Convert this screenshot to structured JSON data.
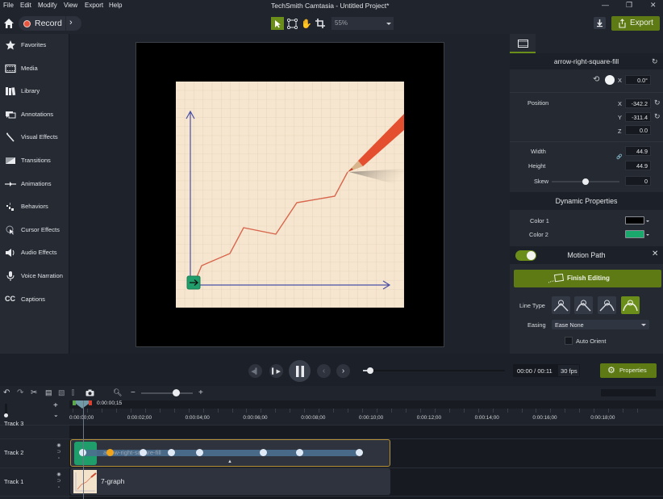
{
  "menu": {
    "items": [
      "File",
      "Edit",
      "Modify",
      "View",
      "Export",
      "Help"
    ]
  },
  "window": {
    "title": "TechSmith Camtasia - Untitled Project*"
  },
  "toolbar": {
    "record_label": "Record",
    "zoom_value": "55%",
    "export_label": "Export",
    "tools": [
      "select-tool",
      "edit-path-tool",
      "pan-tool",
      "crop-tool"
    ]
  },
  "sidebar": {
    "items": [
      {
        "label": "Favorites",
        "icon": "star-icon"
      },
      {
        "label": "Media",
        "icon": "film-icon"
      },
      {
        "label": "Library",
        "icon": "library-icon"
      },
      {
        "label": "Annotations",
        "icon": "annotation-icon"
      },
      {
        "label": "Visual Effects",
        "icon": "magic-wand-icon"
      },
      {
        "label": "Transitions",
        "icon": "transition-icon"
      },
      {
        "label": "Animations",
        "icon": "animation-icon"
      },
      {
        "label": "Behaviors",
        "icon": "behaviors-icon"
      },
      {
        "label": "Cursor Effects",
        "icon": "cursor-icon"
      },
      {
        "label": "Audio Effects",
        "icon": "speaker-icon"
      },
      {
        "label": "Voice Narration",
        "icon": "microphone-icon"
      },
      {
        "label": "Captions",
        "icon": "cc-icon"
      }
    ]
  },
  "properties": {
    "object_name": "arrow-right-square-fill",
    "rotation": {
      "axis": "X",
      "value": "0.0°"
    },
    "position": {
      "label": "Position",
      "x": "-342.2",
      "y": "-311.4",
      "z": "0.0"
    },
    "width": {
      "label": "Width",
      "value": "44.9"
    },
    "height": {
      "label": "Height",
      "value": "44.9"
    },
    "skew": {
      "label": "Skew",
      "value": "0",
      "slider_fraction": 0.5
    },
    "dynamic_title": "Dynamic Properties",
    "color1": {
      "label": "Color 1",
      "value": "#000000"
    },
    "color2": {
      "label": "Color 2",
      "value": "#1aa86d"
    },
    "motion_path": {
      "title": "Motion Path",
      "enabled": true,
      "finish_label": "Finish Editing",
      "line_type_label": "Line Type",
      "line_type_selected": 3,
      "easing_label": "Easing",
      "easing_value": "Ease None",
      "auto_orient_label": "Auto Orient",
      "auto_orient": false
    }
  },
  "transport": {
    "time": "00:00 / 00:11",
    "fps": "30 fps",
    "properties_label": "Properties",
    "scrub_fraction": 0.03
  },
  "timeline": {
    "playhead_time": "0:00:00;15",
    "ruler": [
      "0:00:00;00",
      "0:00:02;00",
      "0:00:04;00",
      "0:00:06;00",
      "0:00:08;00",
      "0:00:10;00",
      "0:00:12;00",
      "0:00:14;00",
      "0:00:16;00",
      "0:00:18;00"
    ],
    "tracks": [
      {
        "name": "Track 3"
      },
      {
        "name": "Track 2",
        "clip": "arrow-right-square-fill"
      },
      {
        "name": "Track 1",
        "clip": "7-graph"
      }
    ]
  },
  "colors": {
    "accent": "#6b8e1b",
    "record": "#e8553e",
    "selection_border": "#b5913a"
  }
}
